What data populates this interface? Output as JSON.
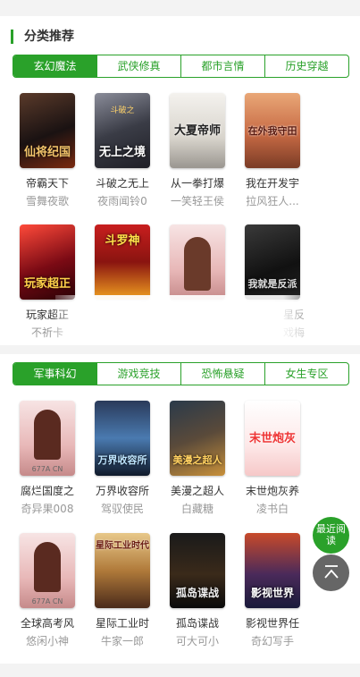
{
  "section": {
    "title": "分类推荐"
  },
  "tabs_row1": [
    "玄幻魔法",
    "武侠修真",
    "都市言情",
    "历史穿越"
  ],
  "tabs_row2": [
    "军事科幻",
    "游戏竞技",
    "恐怖悬疑",
    "女生专区"
  ],
  "books": [
    {
      "title": "帝霸天下",
      "author": "雪舞夜歌",
      "cover_text": "仙将纪国",
      "cover_tag": ""
    },
    {
      "title": "斗破之无上",
      "author": "夜雨闻铃0",
      "cover_text": "无上之境",
      "cover_tag": "斗破之"
    },
    {
      "title": "从一拳打爆",
      "author": "一笑轻王侯",
      "cover_text": "大夏帝师",
      "cover_tag": ""
    },
    {
      "title": "我在开发宇",
      "author": "拉风狂人...",
      "cover_text": "在外我守田",
      "cover_tag": ""
    },
    {
      "title": "玩家超正",
      "author": "不祈卡",
      "cover_text": "玩家超正",
      "cover_tag": ""
    },
    {
      "title": "",
      "author": "",
      "cover_text": "斗罗神",
      "cover_tag": ""
    },
    {
      "title": "",
      "author": "",
      "cover_text": "",
      "cover_tag": ""
    },
    {
      "title": "星反",
      "author": "戏梅",
      "cover_text": "我就是反派",
      "cover_tag": ""
    },
    {
      "title": "腐烂国度之",
      "author": "奇异果008",
      "cover_text": "",
      "cover_tag": "677A CN"
    },
    {
      "title": "万界收容所",
      "author": "驾驭使民",
      "cover_text": "万界收容所",
      "cover_tag": ""
    },
    {
      "title": "美漫之超人",
      "author": "白藏糖",
      "cover_text": "美漫之超人",
      "cover_tag": ""
    },
    {
      "title": "末世炮灰养",
      "author": "凌书白",
      "cover_text": "末世炮灰",
      "cover_tag": ""
    },
    {
      "title": "全球高考风",
      "author": "悠闲小神",
      "cover_text": "",
      "cover_tag": "677A CN"
    },
    {
      "title": "星际工业时",
      "author": "牛家一郎",
      "cover_text": "星际工业时代",
      "cover_tag": ""
    },
    {
      "title": "孤岛谍战",
      "author": "可大可小",
      "cover_text": "孤岛谍战",
      "cover_tag": ""
    },
    {
      "title": "影视世界任",
      "author": "奇幻写手",
      "cover_text": "影视世界",
      "cover_tag": ""
    }
  ],
  "float_read": "最近阅读",
  "colors": {
    "accent": "#2aa12a",
    "title": "#333333",
    "author": "#999999"
  }
}
